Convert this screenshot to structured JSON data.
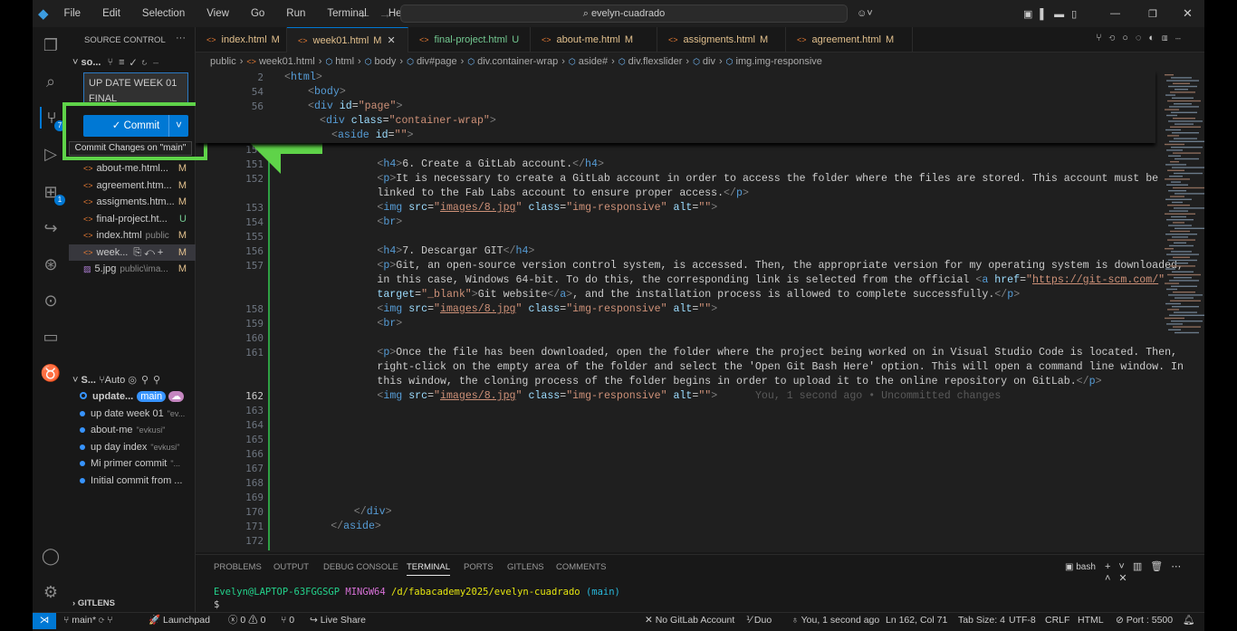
{
  "titlebar": {
    "menus": [
      "File",
      "Edit",
      "Selection",
      "View",
      "Go",
      "Run",
      "Terminal",
      "Help"
    ],
    "search": "evelyn-cuadrado"
  },
  "activity": {
    "scm_badge": "7",
    "ext_badge": "1"
  },
  "sidebar": {
    "title": "SOURCE CONTROL",
    "repo_label": "so...",
    "commit_message": "UP DATE WEEK 01 FINAL",
    "commit_button": "Commit",
    "tooltip": "Commit Changes on \"main\"",
    "changes": [
      {
        "name": "about-me.html...",
        "status": "M"
      },
      {
        "name": "agreement.htm...",
        "status": "M"
      },
      {
        "name": "assigments.htm...",
        "status": "M"
      },
      {
        "name": "final-project.ht...",
        "status": "U"
      },
      {
        "name": "index.html",
        "path": "public",
        "status": "M"
      },
      {
        "name": "week...",
        "status": "M"
      },
      {
        "name": "5.jpg",
        "path": "public\\ima...",
        "status": "M"
      }
    ],
    "graph_header": "S...",
    "graph_auto": "Auto",
    "commits": [
      {
        "msg": "update...",
        "branch": "main"
      },
      {
        "msg": "up date week 01",
        "author": "\"ev..."
      },
      {
        "msg": "about-me",
        "author": "\"evkusi\""
      },
      {
        "msg": "up day index",
        "author": "\"evkusi\""
      },
      {
        "msg": "Mi primer commit",
        "author": "\"..."
      },
      {
        "msg": "Initial commit from ..."
      }
    ],
    "gitlens": "GITLENS"
  },
  "tabs": [
    {
      "name": "index.html",
      "status": "M"
    },
    {
      "name": "week01.html",
      "status": "M",
      "active": true
    },
    {
      "name": "final-project.html",
      "status": "U"
    },
    {
      "name": "about-me.html",
      "status": "M"
    },
    {
      "name": "assigments.html",
      "status": "M"
    },
    {
      "name": "agreement.html",
      "status": "M"
    }
  ],
  "breadcrumb": [
    "public",
    "week01.html",
    "html",
    "body",
    "div#page",
    "div.container-wrap",
    "aside#",
    "div.flexslider",
    "div",
    "img.img-responsive"
  ],
  "editor": {
    "sticky": [
      {
        "n": "2",
        "i": 0,
        "tok": [
          [
            "t",
            "<"
          ],
          [
            "tn",
            "html"
          ],
          [
            "t",
            ">"
          ]
        ]
      },
      {
        "n": "54",
        "i": 2,
        "tok": [
          [
            "t",
            "<"
          ],
          [
            "tn",
            "body"
          ],
          [
            "t",
            ">"
          ]
        ]
      },
      {
        "n": "56",
        "i": 2,
        "tok": [
          [
            "t",
            "<"
          ],
          [
            "tn",
            "div"
          ],
          [
            "at",
            " id"
          ],
          [
            "",
            "="
          ],
          [
            "sv",
            "\"page\""
          ],
          [
            "t",
            ">"
          ]
        ]
      },
      {
        "n": "",
        "i": 3,
        "tok": [
          [
            "t",
            "<"
          ],
          [
            "tn",
            "div"
          ],
          [
            "at",
            " class"
          ],
          [
            "",
            "="
          ],
          [
            "sv",
            "\"container-wrap\""
          ],
          [
            "t",
            ">"
          ]
        ]
      },
      {
        "n": "",
        "i": 4,
        "tok": [
          [
            "t",
            "<"
          ],
          [
            "tn",
            "aside"
          ],
          [
            "at",
            " id"
          ],
          [
            "",
            "="
          ],
          [
            "sv",
            "\"\""
          ],
          [
            "t",
            ">"
          ]
        ]
      }
    ],
    "lines": [
      {
        "n": "150",
        "tok": []
      },
      {
        "n": "151",
        "i": 8,
        "tok": [
          [
            "t",
            "<"
          ],
          [
            "tn",
            "h4"
          ],
          [
            "t",
            ">"
          ],
          [
            "",
            "6. Create a GitLab account."
          ],
          [
            "t",
            "</"
          ],
          [
            "tn",
            "h4"
          ],
          [
            "t",
            ">"
          ]
        ]
      },
      {
        "n": "152",
        "i": 8,
        "tok": [
          [
            "t",
            "<"
          ],
          [
            "tn",
            "p"
          ],
          [
            "t",
            ">"
          ],
          [
            "",
            "It is necessary to create a GitLab account in order to access the folder where the files are stored. This account must be"
          ]
        ]
      },
      {
        "n": "",
        "i": 8,
        "tok": [
          [
            "",
            "linked to the Fab Labs account to ensure proper access."
          ],
          [
            "t",
            "</"
          ],
          [
            "tn",
            "p"
          ],
          [
            "t",
            ">"
          ]
        ]
      },
      {
        "n": "153",
        "i": 8,
        "tok": [
          [
            "t",
            "<"
          ],
          [
            "tn",
            "img"
          ],
          [
            "at",
            " src"
          ],
          [
            "",
            "="
          ],
          [
            "sv",
            "\""
          ],
          [
            "lk",
            "images/8.jpg"
          ],
          [
            "sv",
            "\""
          ],
          [
            "at",
            " class"
          ],
          [
            "",
            "="
          ],
          [
            "sv",
            "\"img-responsive\""
          ],
          [
            "at",
            " alt"
          ],
          [
            "",
            "="
          ],
          [
            "sv",
            "\"\""
          ],
          [
            "t",
            ">"
          ]
        ]
      },
      {
        "n": "154",
        "i": 8,
        "tok": [
          [
            "t",
            "<"
          ],
          [
            "tn",
            "br"
          ],
          [
            "t",
            ">"
          ]
        ]
      },
      {
        "n": "155",
        "tok": []
      },
      {
        "n": "156",
        "i": 8,
        "tok": [
          [
            "t",
            "<"
          ],
          [
            "tn",
            "h4"
          ],
          [
            "t",
            ">"
          ],
          [
            "",
            "7. Descargar GIT"
          ],
          [
            "t",
            "</"
          ],
          [
            "tn",
            "h4"
          ],
          [
            "t",
            ">"
          ]
        ]
      },
      {
        "n": "157",
        "i": 8,
        "tok": [
          [
            "t",
            "<"
          ],
          [
            "tn",
            "p"
          ],
          [
            "t",
            ">"
          ],
          [
            "",
            "Git, an open-source version control system, is accessed. Then, the appropriate version for my operating system is downloaded,"
          ]
        ]
      },
      {
        "n": "",
        "i": 8,
        "tok": [
          [
            "",
            "in this case, Windows 64-bit. To do this, the corresponding link is selected from the official "
          ],
          [
            "t",
            "<"
          ],
          [
            "tn",
            "a"
          ],
          [
            "at",
            " href"
          ],
          [
            "",
            "="
          ],
          [
            "sv",
            "\""
          ],
          [
            "lk",
            "https://git-scm.com/"
          ],
          [
            "sv",
            "\""
          ]
        ]
      },
      {
        "n": "",
        "i": 8,
        "tok": [
          [
            "at",
            "target"
          ],
          [
            "",
            "="
          ],
          [
            "sv",
            "\"_blank\""
          ],
          [
            "t",
            ">"
          ],
          [
            "",
            "Git website"
          ],
          [
            "t",
            "</"
          ],
          [
            "tn",
            "a"
          ],
          [
            "t",
            ">"
          ],
          [
            "",
            ", and the installation process is allowed to complete successfully."
          ],
          [
            "t",
            "</"
          ],
          [
            "tn",
            "p"
          ],
          [
            "t",
            ">"
          ]
        ]
      },
      {
        "n": "158",
        "i": 8,
        "tok": [
          [
            "t",
            "<"
          ],
          [
            "tn",
            "img"
          ],
          [
            "at",
            " src"
          ],
          [
            "",
            "="
          ],
          [
            "sv",
            "\""
          ],
          [
            "lk",
            "images/8.jpg"
          ],
          [
            "sv",
            "\""
          ],
          [
            "at",
            " class"
          ],
          [
            "",
            "="
          ],
          [
            "sv",
            "\"img-responsive\""
          ],
          [
            "at",
            " alt"
          ],
          [
            "",
            "="
          ],
          [
            "sv",
            "\"\""
          ],
          [
            "t",
            ">"
          ]
        ]
      },
      {
        "n": "159",
        "i": 8,
        "tok": [
          [
            "t",
            "<"
          ],
          [
            "tn",
            "br"
          ],
          [
            "t",
            ">"
          ]
        ]
      },
      {
        "n": "160",
        "tok": []
      },
      {
        "n": "161",
        "i": 8,
        "tok": [
          [
            "t",
            "<"
          ],
          [
            "tn",
            "p"
          ],
          [
            "t",
            ">"
          ],
          [
            "",
            "Once the file has been downloaded, open the folder where the project being worked on in Visual Studio Code is located. Then,"
          ]
        ]
      },
      {
        "n": "",
        "i": 8,
        "tok": [
          [
            "",
            "right-click on the empty area of the folder and select the 'Open Git Bash Here' option. This will open a command line window. In"
          ]
        ]
      },
      {
        "n": "",
        "i": 8,
        "tok": [
          [
            "",
            "this window, the cloning process of the folder begins in order to upload it to the online repository on GitLab."
          ],
          [
            "t",
            "</"
          ],
          [
            "tn",
            "p"
          ],
          [
            "t",
            ">"
          ]
        ]
      },
      {
        "n": "162",
        "i": 8,
        "cur": true,
        "tok": [
          [
            "t",
            "<"
          ],
          [
            "tn",
            "img"
          ],
          [
            "at",
            " src"
          ],
          [
            "",
            "="
          ],
          [
            "sv",
            "\""
          ],
          [
            "lk",
            "images/8.jpg"
          ],
          [
            "sv",
            "\""
          ],
          [
            "at",
            " class"
          ],
          [
            "",
            "="
          ],
          [
            "sv",
            "\"img-responsive\""
          ],
          [
            "at",
            " alt"
          ],
          [
            "",
            "="
          ],
          [
            "sv",
            "\"\""
          ],
          [
            "t",
            ">"
          ],
          [
            "gh",
            "      You, 1 second ago • Uncommitted changes"
          ]
        ]
      },
      {
        "n": "163",
        "tok": []
      },
      {
        "n": "164",
        "tok": []
      },
      {
        "n": "165",
        "tok": []
      },
      {
        "n": "166",
        "tok": []
      },
      {
        "n": "167",
        "tok": []
      },
      {
        "n": "168",
        "tok": []
      },
      {
        "n": "169",
        "tok": []
      },
      {
        "n": "170",
        "i": 6,
        "tok": [
          [
            "t",
            "</"
          ],
          [
            "tn",
            "div"
          ],
          [
            "t",
            ">"
          ]
        ]
      },
      {
        "n": "171",
        "i": 4,
        "tok": [
          [
            "t",
            "</"
          ],
          [
            "tn",
            "aside"
          ],
          [
            "t",
            ">"
          ]
        ]
      },
      {
        "n": "172",
        "tok": []
      }
    ]
  },
  "panel": {
    "tabs": [
      "PROBLEMS",
      "OUTPUT",
      "DEBUG CONSOLE",
      "TERMINAL",
      "PORTS",
      "GITLENS",
      "COMMENTS"
    ],
    "active": "TERMINAL",
    "shell": "bash",
    "prompt_user": "Evelyn@LAPTOP-63FGGSGP",
    "prompt_env": "MINGW64",
    "prompt_path": "/d/fabacademy2025/evelyn-cuadrado",
    "prompt_branch": "(main)",
    "prompt_symbol": "$"
  },
  "status": {
    "branch": "main*",
    "launchpad": "Launchpad",
    "errors": "0",
    "warnings": "0",
    "ports_count": "0",
    "liveshare": "Live Share",
    "gitlab": "No GitLab Account",
    "duo": "Duo",
    "blame": "You, 1 second ago",
    "position": "Ln 162, Col 71",
    "tabsize": "Tab Size: 4",
    "encoding": "UTF-8",
    "eol": "CRLF",
    "language": "HTML",
    "port": "Port : 5500"
  },
  "colors": {
    "accent": "#0078d4",
    "highlight": "#5fd349",
    "modified": "#e2c08d",
    "untracked": "#73c991"
  }
}
